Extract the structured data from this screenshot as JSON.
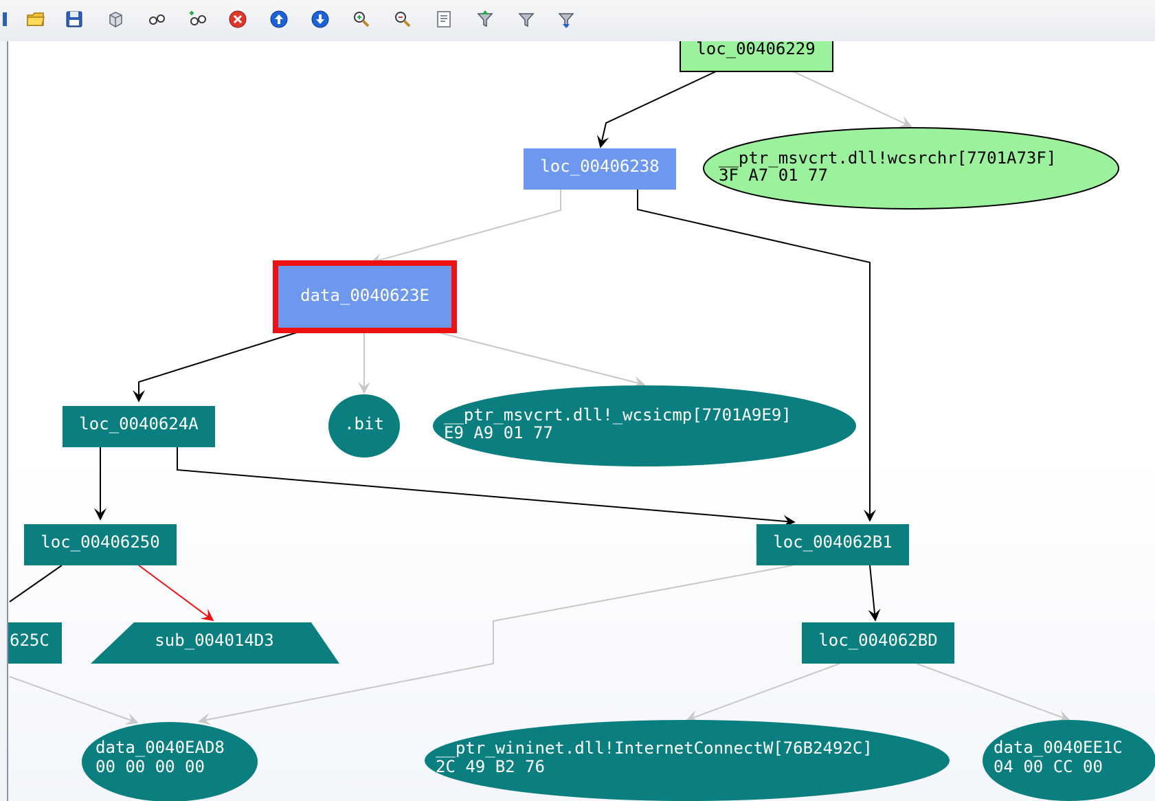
{
  "toolbar": {
    "icons": [
      "open-folder",
      "save",
      "cube",
      "glasses",
      "glasses-plus",
      "stop",
      "arrow-up",
      "arrow-down",
      "zoom-in",
      "zoom-out",
      "notes",
      "filter-up",
      "filter",
      "filter-down"
    ]
  },
  "colors": {
    "teal": "#0b7f7f",
    "blue_node": "#6e97ee",
    "green_node": "#9cf29c",
    "selected_border": "#ee1111",
    "edge_black": "#000000",
    "edge_gray": "#c8c8c8",
    "edge_red": "#ee1111"
  },
  "graph": {
    "nodes": {
      "loc_00406229": {
        "label": "loc_00406229"
      },
      "loc_00406238": {
        "label": "loc_00406238"
      },
      "ptr_wcsrchr": {
        "line1": "__ptr_msvcrt.dll!wcsrchr[7701A73F]",
        "line2": "3F A7 01 77"
      },
      "data_0040623E": {
        "label": "data_0040623E"
      },
      "loc_0040624A": {
        "label": "loc_0040624A"
      },
      "bit": {
        "label": ".bit"
      },
      "ptr_wcsicmp": {
        "line1": "__ptr_msvcrt.dll!_wcsicmp[7701A9E9]",
        "line2": "E9 A9 01 77"
      },
      "loc_00406250": {
        "label": "loc_00406250"
      },
      "loc_004062B1": {
        "label": "loc_004062B1"
      },
      "loc_0040625C": {
        "label": "625C"
      },
      "sub_004014D3": {
        "label": "sub_004014D3"
      },
      "loc_004062BD": {
        "label": "loc_004062BD"
      },
      "data_0040EAD8": {
        "line1": "data_0040EAD8",
        "line2": "00 00 00 00"
      },
      "ptr_InternetConnectW": {
        "line1": "__ptr_wininet.dll!InternetConnectW[76B2492C]",
        "line2": "2C 49 B2 76"
      },
      "data_0040EE1C": {
        "line1": "data_0040EE1C",
        "line2": "04 00 CC 00"
      }
    }
  }
}
